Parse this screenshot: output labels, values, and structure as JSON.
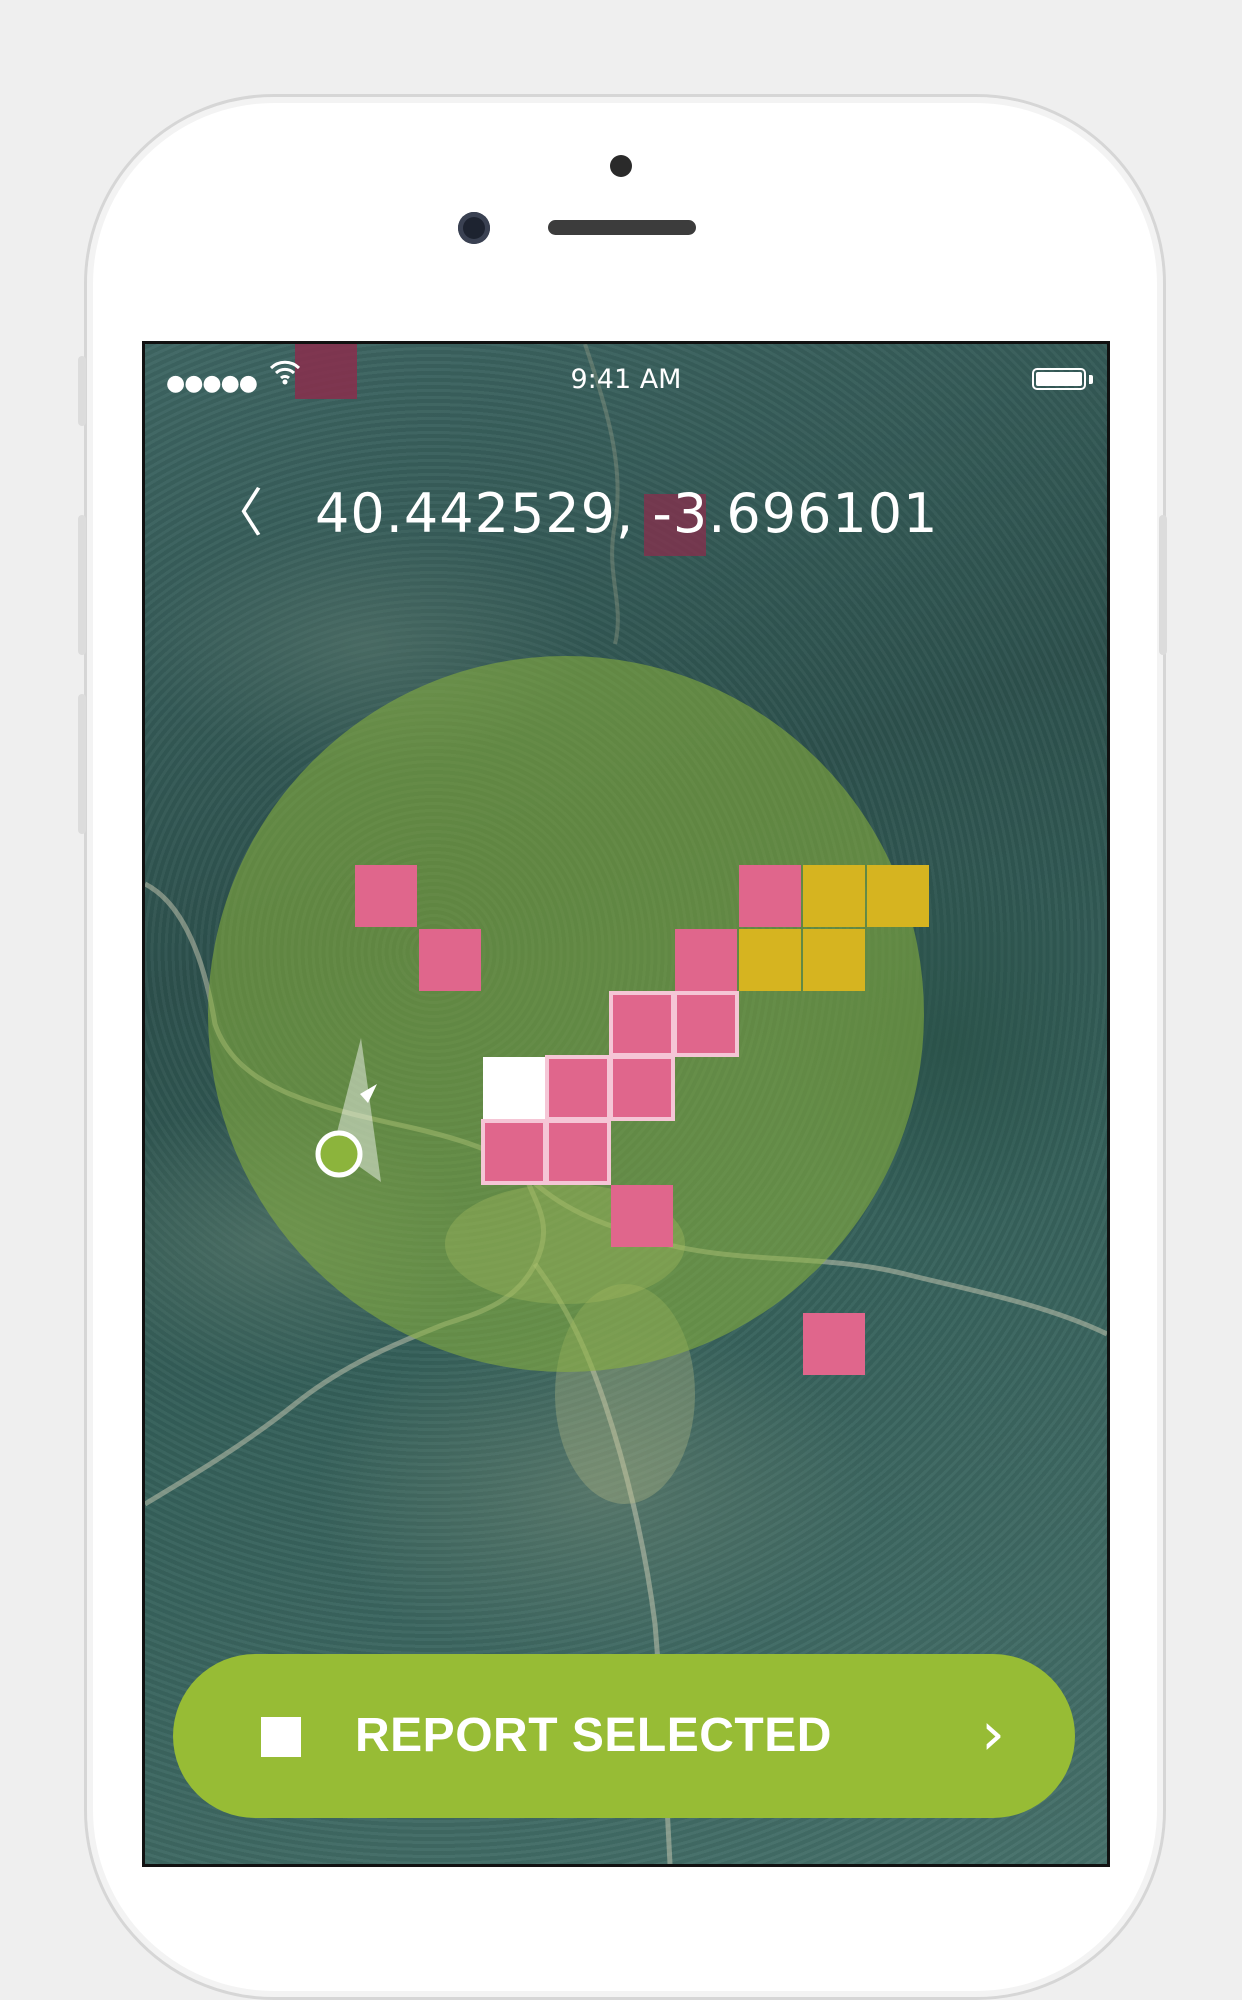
{
  "status_bar": {
    "signal": "●●●●●",
    "wifi_icon": "wifi-icon",
    "time": "9:41 AM",
    "battery_icon": "battery-icon"
  },
  "header": {
    "back_icon": "chevron-left-icon",
    "back_glyph": "〈",
    "coordinates": "40.442529, -3.696101"
  },
  "map": {
    "circle_color": "#8cb43c",
    "location_marker_color": "#8cb43c",
    "alert_colors": {
      "pink": "#e0668c",
      "gold": "#d6b420",
      "selected": "#ffffff",
      "dark": "#8a2e4c"
    },
    "grid_cells": [
      {
        "col": 0,
        "row": 0,
        "type": "pink"
      },
      {
        "col": 1,
        "row": 1,
        "type": "pink"
      },
      {
        "col": 6,
        "row": 0,
        "type": "pink"
      },
      {
        "col": 7,
        "row": 0,
        "type": "gold"
      },
      {
        "col": 8,
        "row": 0,
        "type": "gold"
      },
      {
        "col": 5,
        "row": 1,
        "type": "pink"
      },
      {
        "col": 6,
        "row": 1,
        "type": "gold"
      },
      {
        "col": 7,
        "row": 1,
        "type": "gold"
      },
      {
        "col": 4,
        "row": 2,
        "type": "pink-outlined"
      },
      {
        "col": 5,
        "row": 2,
        "type": "pink-outlined"
      },
      {
        "col": 2,
        "row": 3,
        "type": "selected"
      },
      {
        "col": 3,
        "row": 3,
        "type": "pink-outlined"
      },
      {
        "col": 4,
        "row": 3,
        "type": "pink-outlined"
      },
      {
        "col": 2,
        "row": 4,
        "type": "pink-outlined"
      },
      {
        "col": 3,
        "row": 4,
        "type": "pink-outlined"
      },
      {
        "col": 4,
        "row": 5,
        "type": "pink"
      },
      {
        "col": 7,
        "row": 7,
        "type": "pink"
      }
    ]
  },
  "report_button": {
    "checkbox_icon": "checkbox-icon",
    "label": "REPORT SELECTED",
    "arrow_icon": "chevron-right-icon",
    "arrow_glyph": "›",
    "color": "#97bc35"
  }
}
